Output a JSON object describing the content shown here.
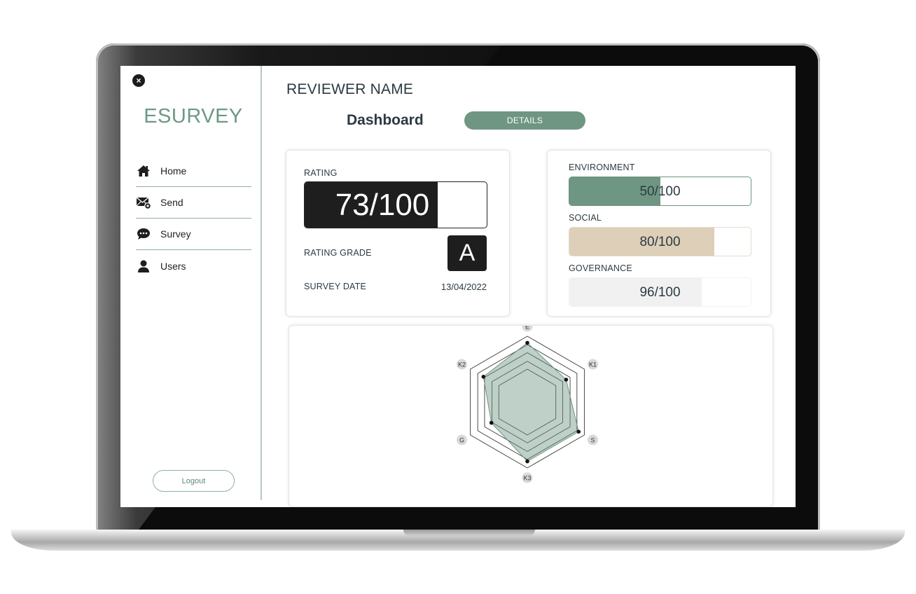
{
  "app": {
    "logo": "ESURVEY",
    "close_icon": "×"
  },
  "sidebar": {
    "items": [
      {
        "label": "Home",
        "icon": "home-icon"
      },
      {
        "label": "Send",
        "icon": "send-mail-icon"
      },
      {
        "label": "Survey",
        "icon": "chat-bubble-icon"
      },
      {
        "label": "Users",
        "icon": "user-icon"
      }
    ],
    "logout_label": "Logout"
  },
  "header": {
    "reviewer": "REVIEWER NAME",
    "title": "Dashboard",
    "details_label": "DETAILS"
  },
  "rating_card": {
    "rating_label": "RATING",
    "rating_text": "73/100",
    "rating_value": 73,
    "rating_max": 100,
    "grade_label": "RATING GRADE",
    "grade": "A",
    "date_label": "SURVEY DATE",
    "date": "13/04/2022"
  },
  "metrics": {
    "environment": {
      "label": "ENVIRONMENT",
      "text": "50/100",
      "value": 50
    },
    "social": {
      "label": "SOCIAL",
      "text": "80/100",
      "value": 80
    },
    "governance": {
      "label": "GOVERNANCE",
      "text": "96/100",
      "value": 96
    }
  },
  "colors": {
    "accent": "#6e9682",
    "social": "#ddcfb8",
    "governance": "#f1f1f1",
    "dark": "#1e1e1e"
  },
  "chart_data": {
    "type": "radar",
    "categories": [
      "E",
      "K1",
      "S",
      "K3",
      "G",
      "K2"
    ],
    "values": [
      90,
      68,
      90,
      90,
      63,
      77
    ],
    "ylim": [
      0,
      100
    ],
    "grid_levels": [
      50,
      62,
      75,
      87,
      100
    ]
  }
}
